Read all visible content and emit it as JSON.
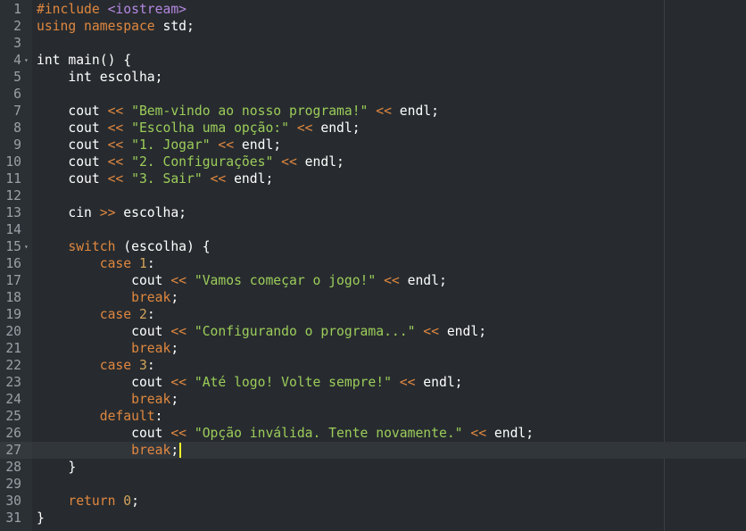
{
  "editor": {
    "lines": [
      {
        "n": "1",
        "tokens": [
          [
            "pp",
            "#include "
          ],
          [
            "inc",
            "<iostream>"
          ]
        ]
      },
      {
        "n": "2",
        "tokens": [
          [
            "kw",
            "using namespace"
          ],
          [
            "txt",
            " std;"
          ]
        ]
      },
      {
        "n": "3",
        "tokens": []
      },
      {
        "n": "4",
        "fold": "▾",
        "tokens": [
          [
            "txt",
            "int main() {"
          ]
        ]
      },
      {
        "n": "5",
        "tokens": [
          [
            "txt",
            "    int escolha;"
          ]
        ]
      },
      {
        "n": "6",
        "tokens": []
      },
      {
        "n": "7",
        "tokens": [
          [
            "txt",
            "    cout "
          ],
          [
            "op",
            "<<"
          ],
          [
            "txt",
            " "
          ],
          [
            "str",
            "\"Bem-vindo ao nosso programa!\""
          ],
          [
            "txt",
            " "
          ],
          [
            "op",
            "<<"
          ],
          [
            "txt",
            " endl;"
          ]
        ]
      },
      {
        "n": "8",
        "tokens": [
          [
            "txt",
            "    cout "
          ],
          [
            "op",
            "<<"
          ],
          [
            "txt",
            " "
          ],
          [
            "str",
            "\"Escolha uma opção:\""
          ],
          [
            "txt",
            " "
          ],
          [
            "op",
            "<<"
          ],
          [
            "txt",
            " endl;"
          ]
        ]
      },
      {
        "n": "9",
        "tokens": [
          [
            "txt",
            "    cout "
          ],
          [
            "op",
            "<<"
          ],
          [
            "txt",
            " "
          ],
          [
            "str",
            "\"1. Jogar\""
          ],
          [
            "txt",
            " "
          ],
          [
            "op",
            "<<"
          ],
          [
            "txt",
            " endl;"
          ]
        ]
      },
      {
        "n": "10",
        "tokens": [
          [
            "txt",
            "    cout "
          ],
          [
            "op",
            "<<"
          ],
          [
            "txt",
            " "
          ],
          [
            "str",
            "\"2. Configurações\""
          ],
          [
            "txt",
            " "
          ],
          [
            "op",
            "<<"
          ],
          [
            "txt",
            " endl;"
          ]
        ]
      },
      {
        "n": "11",
        "tokens": [
          [
            "txt",
            "    cout "
          ],
          [
            "op",
            "<<"
          ],
          [
            "txt",
            " "
          ],
          [
            "str",
            "\"3. Sair\""
          ],
          [
            "txt",
            " "
          ],
          [
            "op",
            "<<"
          ],
          [
            "txt",
            " endl;"
          ]
        ]
      },
      {
        "n": "12",
        "tokens": []
      },
      {
        "n": "13",
        "tokens": [
          [
            "txt",
            "    cin "
          ],
          [
            "op",
            ">>"
          ],
          [
            "txt",
            " escolha;"
          ]
        ]
      },
      {
        "n": "14",
        "tokens": []
      },
      {
        "n": "15",
        "fold": "▾",
        "tokens": [
          [
            "txt",
            "    "
          ],
          [
            "kw",
            "switch"
          ],
          [
            "txt",
            " (escolha) {"
          ]
        ]
      },
      {
        "n": "16",
        "tokens": [
          [
            "txt",
            "        "
          ],
          [
            "kw",
            "case"
          ],
          [
            "txt",
            " "
          ],
          [
            "num",
            "1"
          ],
          [
            "txt",
            ":"
          ]
        ]
      },
      {
        "n": "17",
        "tokens": [
          [
            "txt",
            "            cout "
          ],
          [
            "op",
            "<<"
          ],
          [
            "txt",
            " "
          ],
          [
            "str",
            "\"Vamos começar o jogo!\""
          ],
          [
            "txt",
            " "
          ],
          [
            "op",
            "<<"
          ],
          [
            "txt",
            " endl;"
          ]
        ]
      },
      {
        "n": "18",
        "tokens": [
          [
            "txt",
            "            "
          ],
          [
            "kw",
            "break"
          ],
          [
            "txt",
            ";"
          ]
        ]
      },
      {
        "n": "19",
        "tokens": [
          [
            "txt",
            "        "
          ],
          [
            "kw",
            "case"
          ],
          [
            "txt",
            " "
          ],
          [
            "num",
            "2"
          ],
          [
            "txt",
            ":"
          ]
        ]
      },
      {
        "n": "20",
        "tokens": [
          [
            "txt",
            "            cout "
          ],
          [
            "op",
            "<<"
          ],
          [
            "txt",
            " "
          ],
          [
            "str",
            "\"Configurando o programa...\""
          ],
          [
            "txt",
            " "
          ],
          [
            "op",
            "<<"
          ],
          [
            "txt",
            " endl;"
          ]
        ]
      },
      {
        "n": "21",
        "tokens": [
          [
            "txt",
            "            "
          ],
          [
            "kw",
            "break"
          ],
          [
            "txt",
            ";"
          ]
        ]
      },
      {
        "n": "22",
        "tokens": [
          [
            "txt",
            "        "
          ],
          [
            "kw",
            "case"
          ],
          [
            "txt",
            " "
          ],
          [
            "num",
            "3"
          ],
          [
            "txt",
            ":"
          ]
        ]
      },
      {
        "n": "23",
        "tokens": [
          [
            "txt",
            "            cout "
          ],
          [
            "op",
            "<<"
          ],
          [
            "txt",
            " "
          ],
          [
            "str",
            "\"Até logo! Volte sempre!\""
          ],
          [
            "txt",
            " "
          ],
          [
            "op",
            "<<"
          ],
          [
            "txt",
            " endl;"
          ]
        ]
      },
      {
        "n": "24",
        "tokens": [
          [
            "txt",
            "            "
          ],
          [
            "kw",
            "break"
          ],
          [
            "txt",
            ";"
          ]
        ]
      },
      {
        "n": "25",
        "tokens": [
          [
            "txt",
            "        "
          ],
          [
            "kw",
            "default"
          ],
          [
            "txt",
            ":"
          ]
        ]
      },
      {
        "n": "26",
        "tokens": [
          [
            "txt",
            "            cout "
          ],
          [
            "op",
            "<<"
          ],
          [
            "txt",
            " "
          ],
          [
            "str",
            "\"Opção inválida. Tente novamente.\""
          ],
          [
            "txt",
            " "
          ],
          [
            "op",
            "<<"
          ],
          [
            "txt",
            " endl;"
          ]
        ]
      },
      {
        "n": "27",
        "active": true,
        "cursor": true,
        "tokens": [
          [
            "txt",
            "            "
          ],
          [
            "kw",
            "break"
          ],
          [
            "txt",
            ";"
          ]
        ]
      },
      {
        "n": "28",
        "tokens": [
          [
            "txt",
            "    }"
          ]
        ]
      },
      {
        "n": "29",
        "tokens": []
      },
      {
        "n": "30",
        "tokens": [
          [
            "txt",
            "    "
          ],
          [
            "kw",
            "return"
          ],
          [
            "txt",
            " "
          ],
          [
            "num",
            "0"
          ],
          [
            "txt",
            ";"
          ]
        ]
      },
      {
        "n": "31",
        "tokens": [
          [
            "txt",
            "}"
          ]
        ]
      }
    ]
  }
}
